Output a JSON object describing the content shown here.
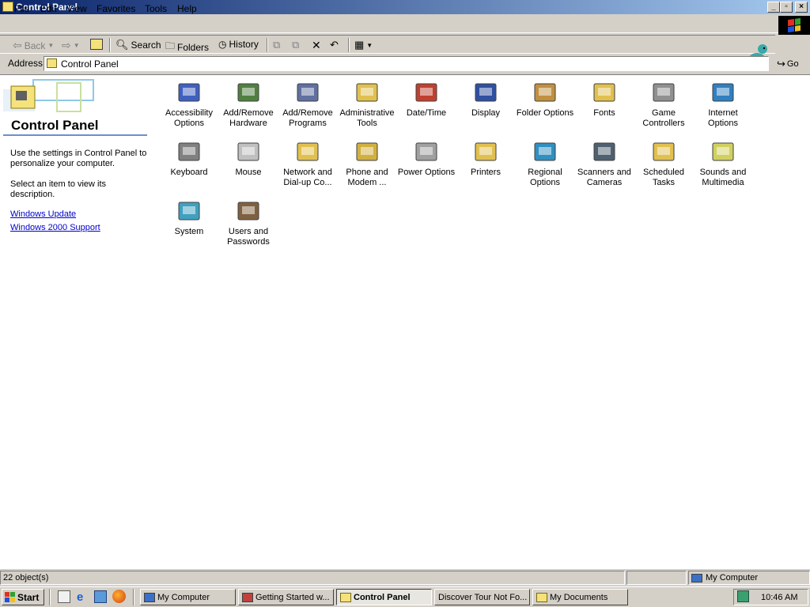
{
  "window": {
    "title": "Control Panel"
  },
  "menu": [
    "File",
    "Edit",
    "View",
    "Favorites",
    "Tools",
    "Help"
  ],
  "toolbar": {
    "back": "Back",
    "search": "Search",
    "folders": "Folders",
    "history": "History"
  },
  "address": {
    "label": "Address",
    "value": "Control Panel",
    "go": "Go"
  },
  "left_pane": {
    "title": "Control Panel",
    "desc1": "Use the settings in Control Panel to personalize your computer.",
    "desc2": "Select an item to view its description.",
    "link1": "Windows Update",
    "link2": "Windows 2000 Support"
  },
  "items": [
    {
      "label": "Accessibility Options",
      "icon": "accessibility-icon"
    },
    {
      "label": "Add/Remove Hardware",
      "icon": "hardware-icon"
    },
    {
      "label": "Add/Remove Programs",
      "icon": "programs-icon"
    },
    {
      "label": "Administrative Tools",
      "icon": "admin-tools-icon"
    },
    {
      "label": "Date/Time",
      "icon": "clock-icon"
    },
    {
      "label": "Display",
      "icon": "display-icon"
    },
    {
      "label": "Folder Options",
      "icon": "folder-options-icon"
    },
    {
      "label": "Fonts",
      "icon": "fonts-icon"
    },
    {
      "label": "Game Controllers",
      "icon": "joystick-icon"
    },
    {
      "label": "Internet Options",
      "icon": "globe-icon"
    },
    {
      "label": "Keyboard",
      "icon": "keyboard-icon"
    },
    {
      "label": "Mouse",
      "icon": "mouse-icon"
    },
    {
      "label": "Network and Dial-up Co...",
      "icon": "network-icon"
    },
    {
      "label": "Phone and Modem ...",
      "icon": "phone-icon"
    },
    {
      "label": "Power Options",
      "icon": "power-icon"
    },
    {
      "label": "Printers",
      "icon": "printer-icon"
    },
    {
      "label": "Regional Options",
      "icon": "regional-globe-icon"
    },
    {
      "label": "Scanners and Cameras",
      "icon": "scanner-icon"
    },
    {
      "label": "Scheduled Tasks",
      "icon": "scheduled-tasks-icon"
    },
    {
      "label": "Sounds and Multimedia",
      "icon": "speaker-icon"
    },
    {
      "label": "System",
      "icon": "computer-icon"
    },
    {
      "label": "Users and Passwords",
      "icon": "users-icon"
    }
  ],
  "status": {
    "objects": "22 object(s)",
    "zone": "My Computer"
  },
  "taskbar": {
    "start": "Start",
    "buttons": [
      "My Computer",
      "Getting Started w...",
      "Control Panel",
      "Discover Tour Not Fo...",
      "My Documents"
    ],
    "clock": "10:46 AM"
  }
}
